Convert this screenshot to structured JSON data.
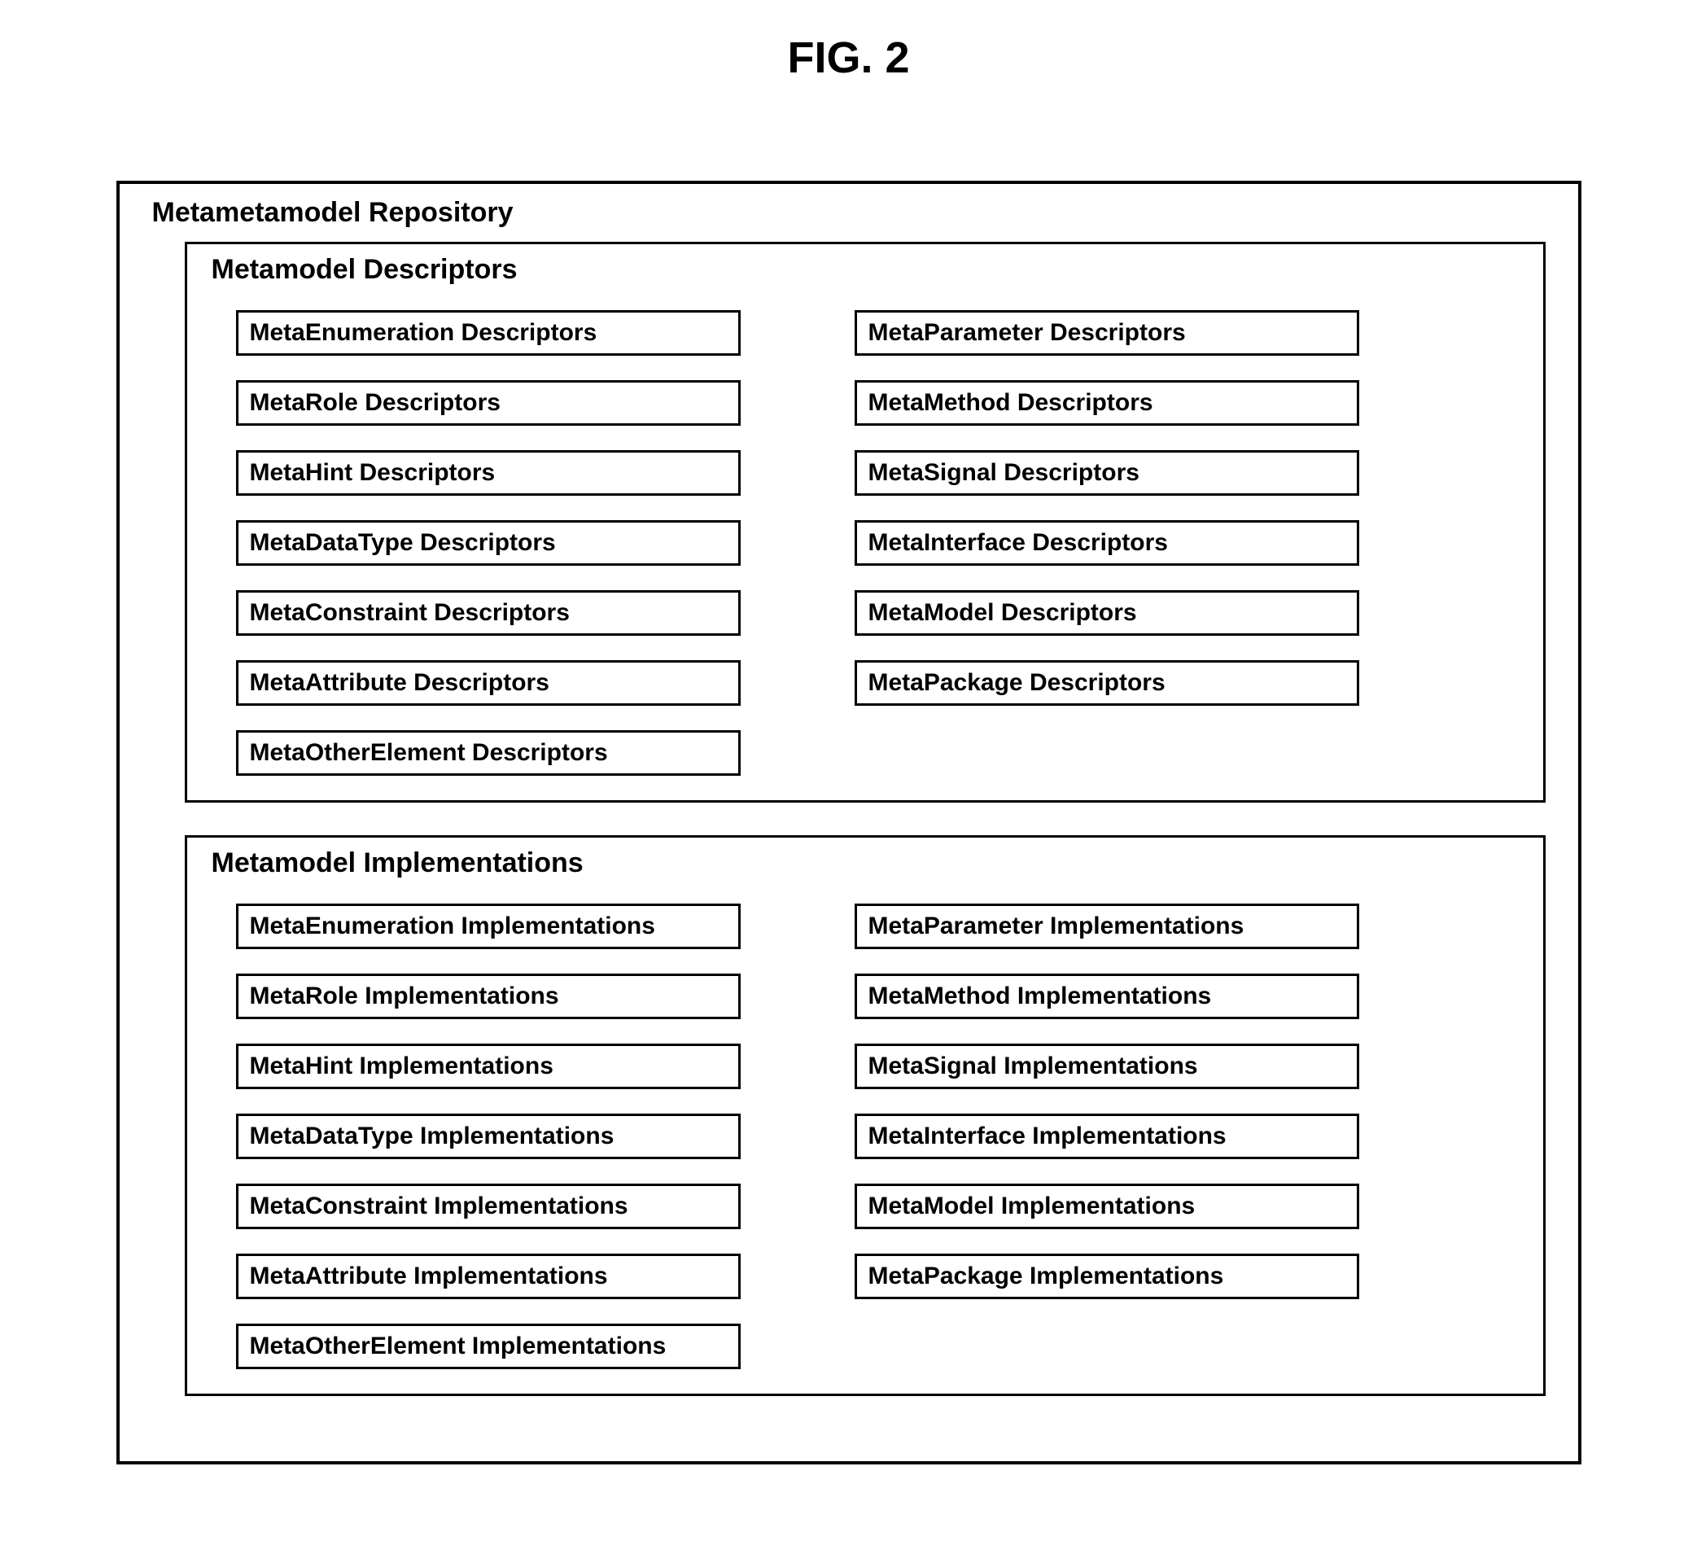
{
  "figure_title": "FIG. 2",
  "repository": {
    "title": "Metametamodel Repository",
    "descriptors": {
      "title": "Metamodel Descriptors",
      "left": [
        "MetaEnumeration Descriptors",
        "MetaRole Descriptors",
        "MetaHint Descriptors",
        "MetaDataType Descriptors",
        "MetaConstraint Descriptors",
        "MetaAttribute Descriptors",
        "MetaOtherElement Descriptors"
      ],
      "right": [
        "MetaParameter Descriptors",
        "MetaMethod Descriptors",
        "MetaSignal Descriptors",
        "MetaInterface Descriptors",
        "MetaModel Descriptors",
        "MetaPackage Descriptors"
      ]
    },
    "implementations": {
      "title": "Metamodel Implementations",
      "left": [
        "MetaEnumeration Implementations",
        "MetaRole Implementations",
        "MetaHint Implementations",
        "MetaDataType Implementations",
        "MetaConstraint Implementations",
        "MetaAttribute Implementations",
        "MetaOtherElement Implementations"
      ],
      "right": [
        "MetaParameter Implementations",
        "MetaMethod Implementations",
        "MetaSignal Implementations",
        "MetaInterface Implementations",
        "MetaModel Implementations",
        "MetaPackage Implementations"
      ]
    }
  }
}
